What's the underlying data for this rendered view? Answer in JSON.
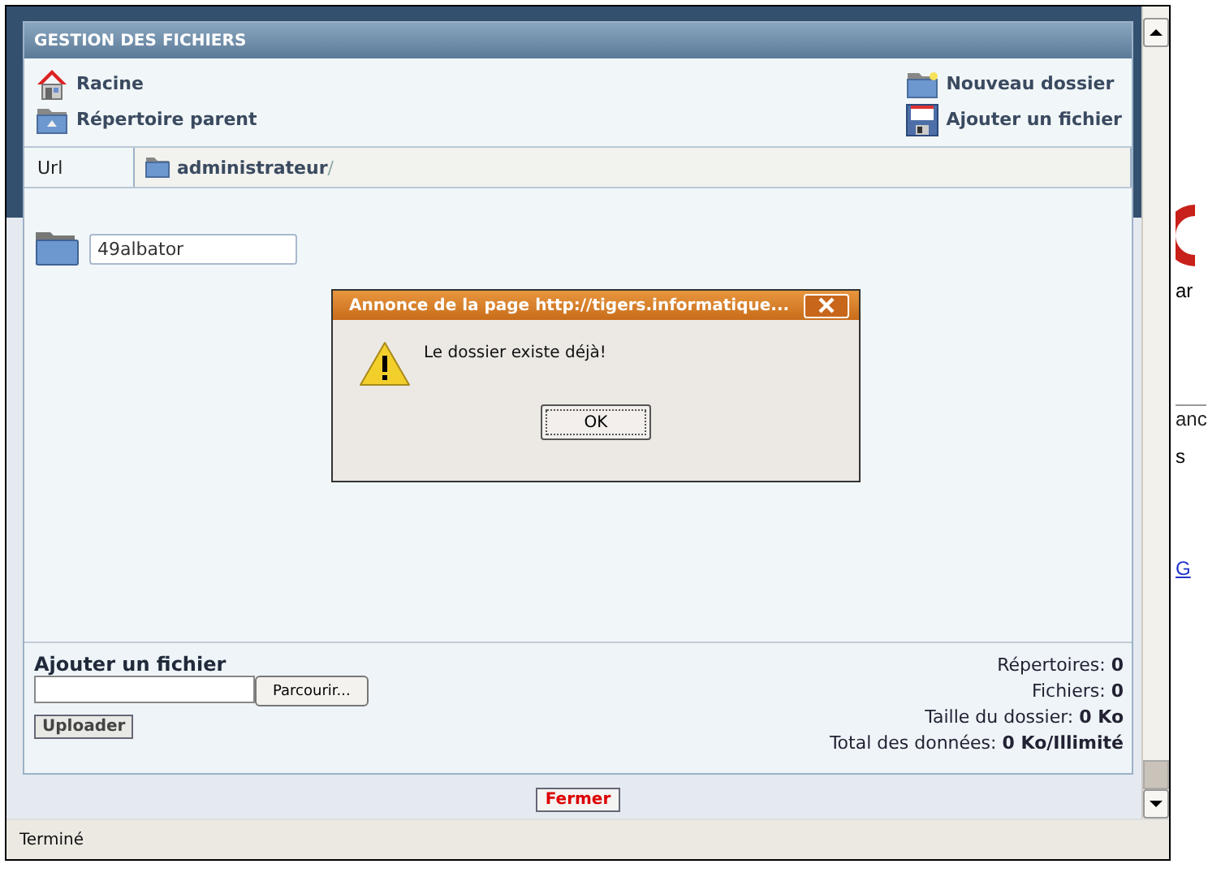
{
  "panel": {
    "title": "GESTION DES FICHIERS",
    "actions_left": [
      {
        "label": "Racine",
        "kind": "home"
      },
      {
        "label": "Répertoire parent",
        "kind": "parent"
      }
    ],
    "actions_right": [
      {
        "label": "Nouveau dossier",
        "kind": "new-folder"
      },
      {
        "label": "Ajouter un fichier",
        "kind": "upload"
      }
    ],
    "url": {
      "label": "Url",
      "path": "administrateur",
      "separator": "/"
    },
    "folders": [
      {
        "name": "49albator"
      }
    ],
    "upload": {
      "title": "Ajouter un fichier",
      "browse_button": "Parcourir...",
      "submit_button": "Uploader"
    },
    "stats": [
      {
        "label": "Répertoires:",
        "value": "0"
      },
      {
        "label": "Fichiers:",
        "value": "0"
      },
      {
        "label": "Taille du dossier:",
        "value": "0 Ko"
      },
      {
        "label": "Total des données:",
        "value": "0 Ko/Illimité"
      }
    ]
  },
  "close_button": "Fermer",
  "status_bar": "Terminé",
  "dialog": {
    "title": "Annonce de la page  http://tigers.informatique...",
    "message": "Le dossier existe déjà!",
    "ok_button": "OK"
  },
  "background_page": [
    {
      "text": "ar",
      "kind": "text"
    },
    {
      "text": "anc",
      "kind": "tab"
    },
    {
      "text": "s",
      "kind": "text"
    },
    {
      "text": "G",
      "kind": "link"
    }
  ]
}
